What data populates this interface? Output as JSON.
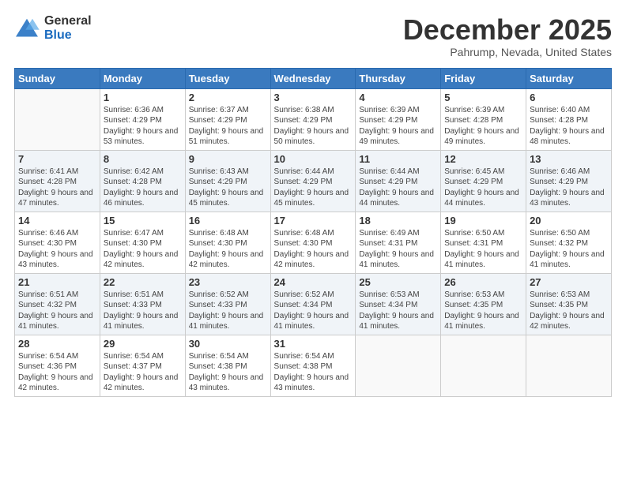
{
  "header": {
    "logo_general": "General",
    "logo_blue": "Blue",
    "title": "December 2025",
    "location": "Pahrump, Nevada, United States"
  },
  "weekdays": [
    "Sunday",
    "Monday",
    "Tuesday",
    "Wednesday",
    "Thursday",
    "Friday",
    "Saturday"
  ],
  "weeks": [
    [
      {
        "day": "",
        "sunrise": "",
        "sunset": "",
        "daylight": ""
      },
      {
        "day": "1",
        "sunrise": "Sunrise: 6:36 AM",
        "sunset": "Sunset: 4:29 PM",
        "daylight": "Daylight: 9 hours and 53 minutes."
      },
      {
        "day": "2",
        "sunrise": "Sunrise: 6:37 AM",
        "sunset": "Sunset: 4:29 PM",
        "daylight": "Daylight: 9 hours and 51 minutes."
      },
      {
        "day": "3",
        "sunrise": "Sunrise: 6:38 AM",
        "sunset": "Sunset: 4:29 PM",
        "daylight": "Daylight: 9 hours and 50 minutes."
      },
      {
        "day": "4",
        "sunrise": "Sunrise: 6:39 AM",
        "sunset": "Sunset: 4:29 PM",
        "daylight": "Daylight: 9 hours and 49 minutes."
      },
      {
        "day": "5",
        "sunrise": "Sunrise: 6:39 AM",
        "sunset": "Sunset: 4:28 PM",
        "daylight": "Daylight: 9 hours and 49 minutes."
      },
      {
        "day": "6",
        "sunrise": "Sunrise: 6:40 AM",
        "sunset": "Sunset: 4:28 PM",
        "daylight": "Daylight: 9 hours and 48 minutes."
      }
    ],
    [
      {
        "day": "7",
        "sunrise": "Sunrise: 6:41 AM",
        "sunset": "Sunset: 4:28 PM",
        "daylight": "Daylight: 9 hours and 47 minutes."
      },
      {
        "day": "8",
        "sunrise": "Sunrise: 6:42 AM",
        "sunset": "Sunset: 4:28 PM",
        "daylight": "Daylight: 9 hours and 46 minutes."
      },
      {
        "day": "9",
        "sunrise": "Sunrise: 6:43 AM",
        "sunset": "Sunset: 4:29 PM",
        "daylight": "Daylight: 9 hours and 45 minutes."
      },
      {
        "day": "10",
        "sunrise": "Sunrise: 6:44 AM",
        "sunset": "Sunset: 4:29 PM",
        "daylight": "Daylight: 9 hours and 45 minutes."
      },
      {
        "day": "11",
        "sunrise": "Sunrise: 6:44 AM",
        "sunset": "Sunset: 4:29 PM",
        "daylight": "Daylight: 9 hours and 44 minutes."
      },
      {
        "day": "12",
        "sunrise": "Sunrise: 6:45 AM",
        "sunset": "Sunset: 4:29 PM",
        "daylight": "Daylight: 9 hours and 44 minutes."
      },
      {
        "day": "13",
        "sunrise": "Sunrise: 6:46 AM",
        "sunset": "Sunset: 4:29 PM",
        "daylight": "Daylight: 9 hours and 43 minutes."
      }
    ],
    [
      {
        "day": "14",
        "sunrise": "Sunrise: 6:46 AM",
        "sunset": "Sunset: 4:30 PM",
        "daylight": "Daylight: 9 hours and 43 minutes."
      },
      {
        "day": "15",
        "sunrise": "Sunrise: 6:47 AM",
        "sunset": "Sunset: 4:30 PM",
        "daylight": "Daylight: 9 hours and 42 minutes."
      },
      {
        "day": "16",
        "sunrise": "Sunrise: 6:48 AM",
        "sunset": "Sunset: 4:30 PM",
        "daylight": "Daylight: 9 hours and 42 minutes."
      },
      {
        "day": "17",
        "sunrise": "Sunrise: 6:48 AM",
        "sunset": "Sunset: 4:30 PM",
        "daylight": "Daylight: 9 hours and 42 minutes."
      },
      {
        "day": "18",
        "sunrise": "Sunrise: 6:49 AM",
        "sunset": "Sunset: 4:31 PM",
        "daylight": "Daylight: 9 hours and 41 minutes."
      },
      {
        "day": "19",
        "sunrise": "Sunrise: 6:50 AM",
        "sunset": "Sunset: 4:31 PM",
        "daylight": "Daylight: 9 hours and 41 minutes."
      },
      {
        "day": "20",
        "sunrise": "Sunrise: 6:50 AM",
        "sunset": "Sunset: 4:32 PM",
        "daylight": "Daylight: 9 hours and 41 minutes."
      }
    ],
    [
      {
        "day": "21",
        "sunrise": "Sunrise: 6:51 AM",
        "sunset": "Sunset: 4:32 PM",
        "daylight": "Daylight: 9 hours and 41 minutes."
      },
      {
        "day": "22",
        "sunrise": "Sunrise: 6:51 AM",
        "sunset": "Sunset: 4:33 PM",
        "daylight": "Daylight: 9 hours and 41 minutes."
      },
      {
        "day": "23",
        "sunrise": "Sunrise: 6:52 AM",
        "sunset": "Sunset: 4:33 PM",
        "daylight": "Daylight: 9 hours and 41 minutes."
      },
      {
        "day": "24",
        "sunrise": "Sunrise: 6:52 AM",
        "sunset": "Sunset: 4:34 PM",
        "daylight": "Daylight: 9 hours and 41 minutes."
      },
      {
        "day": "25",
        "sunrise": "Sunrise: 6:53 AM",
        "sunset": "Sunset: 4:34 PM",
        "daylight": "Daylight: 9 hours and 41 minutes."
      },
      {
        "day": "26",
        "sunrise": "Sunrise: 6:53 AM",
        "sunset": "Sunset: 4:35 PM",
        "daylight": "Daylight: 9 hours and 41 minutes."
      },
      {
        "day": "27",
        "sunrise": "Sunrise: 6:53 AM",
        "sunset": "Sunset: 4:35 PM",
        "daylight": "Daylight: 9 hours and 42 minutes."
      }
    ],
    [
      {
        "day": "28",
        "sunrise": "Sunrise: 6:54 AM",
        "sunset": "Sunset: 4:36 PM",
        "daylight": "Daylight: 9 hours and 42 minutes."
      },
      {
        "day": "29",
        "sunrise": "Sunrise: 6:54 AM",
        "sunset": "Sunset: 4:37 PM",
        "daylight": "Daylight: 9 hours and 42 minutes."
      },
      {
        "day": "30",
        "sunrise": "Sunrise: 6:54 AM",
        "sunset": "Sunset: 4:38 PM",
        "daylight": "Daylight: 9 hours and 43 minutes."
      },
      {
        "day": "31",
        "sunrise": "Sunrise: 6:54 AM",
        "sunset": "Sunset: 4:38 PM",
        "daylight": "Daylight: 9 hours and 43 minutes."
      },
      {
        "day": "",
        "sunrise": "",
        "sunset": "",
        "daylight": ""
      },
      {
        "day": "",
        "sunrise": "",
        "sunset": "",
        "daylight": ""
      },
      {
        "day": "",
        "sunrise": "",
        "sunset": "",
        "daylight": ""
      }
    ]
  ]
}
